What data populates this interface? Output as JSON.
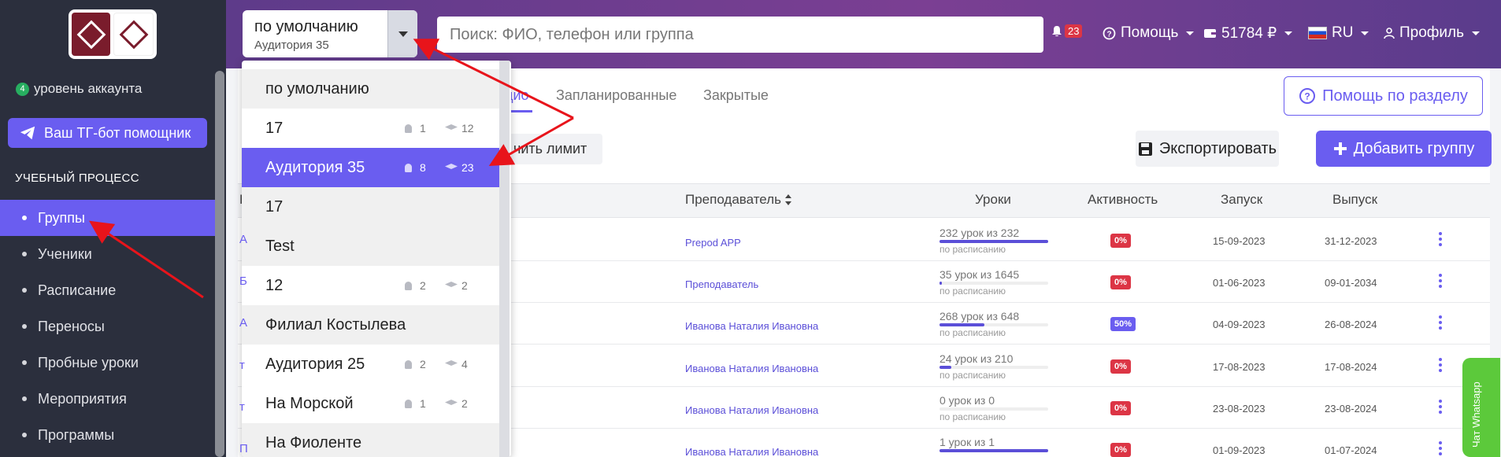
{
  "sidebar": {
    "account_level_count": "4",
    "account_level_label": "уровень аккаунта",
    "tg_button": "Ваш ТГ-бот помощник",
    "section_title": "УЧЕБНЫЙ ПРОЦЕСС",
    "items": [
      {
        "label": "Группы"
      },
      {
        "label": "Ученики"
      },
      {
        "label": "Расписание"
      },
      {
        "label": "Переносы"
      },
      {
        "label": "Пробные уроки"
      },
      {
        "label": "Мероприятия"
      },
      {
        "label": "Программы"
      }
    ]
  },
  "header": {
    "group_select_value": "по умолчанию",
    "group_select_sub": "Аудитория 35",
    "search_placeholder": "Поиск: ФИО, телефон или группа",
    "notifications_count": "23",
    "help_label": "Помощь",
    "balance": "51784 ₽",
    "language": "RU",
    "profile_label": "Профиль"
  },
  "dropdown": {
    "items": [
      {
        "label": "по умолчанию",
        "type": "header"
      },
      {
        "label": "17",
        "students": "1",
        "lessons": "12"
      },
      {
        "label": "Аудитория 35",
        "students": "8",
        "lessons": "23",
        "selected": true
      },
      {
        "label": "17",
        "type": "header"
      },
      {
        "label": "Test",
        "type": "header"
      },
      {
        "label": "12",
        "students": "2",
        "lessons": "2"
      },
      {
        "label": "Филиал Костылева",
        "type": "header"
      },
      {
        "label": "Аудитория 25",
        "students": "2",
        "lessons": "4"
      },
      {
        "label": "На Морской",
        "students": "1",
        "lessons": "2"
      },
      {
        "label": "На Фиоленте",
        "type": "header"
      }
    ]
  },
  "main": {
    "tabs": {
      "active_partial": "дио",
      "planned": "Запланированные",
      "closed": "Закрытые"
    },
    "help_section": "Помощь по разделу",
    "limit_button_partial": "чить лимит",
    "export_button": "Экспортировать",
    "add_group_button": "Добавить группу",
    "columns": {
      "first_partial": "Н",
      "teacher": "Преподаватель",
      "lessons": "Уроки",
      "activity": "Активность",
      "launch": "Запуск",
      "release": "Выпуск"
    },
    "rows": [
      {
        "lead": "А",
        "teacher": "Prepod APP",
        "lessons": "232 урок из 232",
        "schedule": "по расписанию",
        "progress": 1.0,
        "activity": "0%",
        "activity_color": "#dc3545",
        "launch": "15-09-2023",
        "release": "31-12-2023"
      },
      {
        "lead": "Б",
        "teacher": "Преподаватель",
        "lessons": "35 урок из 1645",
        "schedule": "по расписанию",
        "progress": 0.02,
        "activity": "0%",
        "activity_color": "#dc3545",
        "launch": "01-06-2023",
        "release": "09-01-2034"
      },
      {
        "lead": "А",
        "teacher": "Иванова Наталия Ивановна",
        "lessons": "268 урок из 648",
        "schedule": "по расписанию",
        "progress": 0.41,
        "activity": "50%",
        "activity_color": "#6a5df0",
        "launch": "04-09-2023",
        "release": "26-08-2024"
      },
      {
        "lead": "т",
        "teacher": "Иванова Наталия Ивановна",
        "lessons": "24 урок из 210",
        "schedule": "по расписанию",
        "progress": 0.11,
        "activity": "0%",
        "activity_color": "#dc3545",
        "launch": "17-08-2023",
        "release": "17-08-2024"
      },
      {
        "lead": "т",
        "teacher": "Иванова Наталия Ивановна",
        "lessons": "0 урок из 0",
        "schedule": "по расписанию",
        "progress": 0.0,
        "activity": "0%",
        "activity_color": "#dc3545",
        "launch": "23-08-2023",
        "release": "23-08-2024"
      },
      {
        "lead": "П",
        "teacher": "Иванова Наталия Ивановна",
        "lessons": "1 урок из 1",
        "schedule": "",
        "progress": 1.0,
        "activity": "0%",
        "activity_color": "#dc3545",
        "launch": "01-09-2023",
        "release": "01-07-2024"
      }
    ]
  },
  "whatsapp_label": "Чат Whatsapp",
  "colors": {
    "accent": "#6a5df0",
    "sidebar_bg": "#2b2f3d",
    "danger": "#dc3545",
    "whatsapp": "#5cc93b",
    "annotation_arrow": "#e8141b"
  }
}
